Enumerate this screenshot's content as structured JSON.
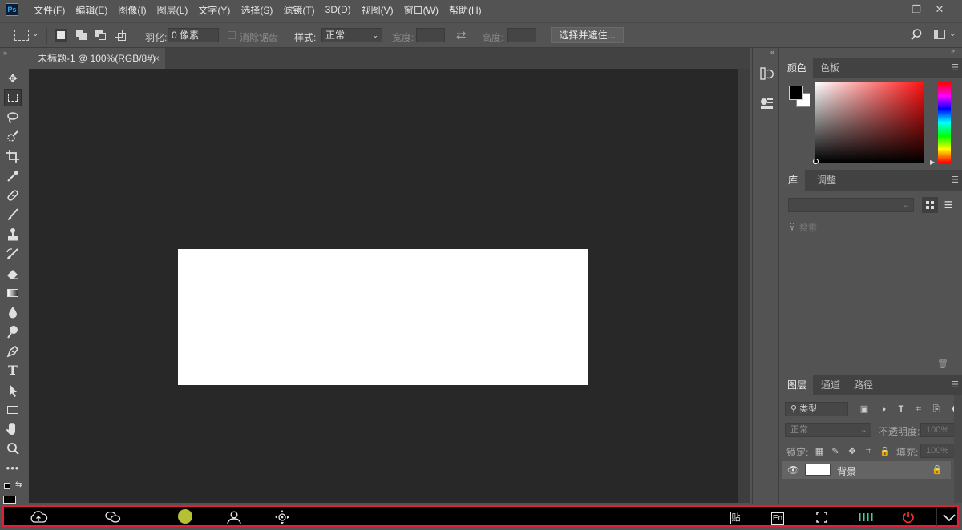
{
  "app": {
    "logo": "Ps"
  },
  "menu": [
    "文件(F)",
    "编辑(E)",
    "图像(I)",
    "图层(L)",
    "文字(Y)",
    "选择(S)",
    "滤镜(T)",
    "3D(D)",
    "视图(V)",
    "窗口(W)",
    "帮助(H)"
  ],
  "window_controls": {
    "minimize": "—",
    "restore": "❐",
    "close": "✕"
  },
  "options": {
    "feather_label": "羽化:",
    "feather_value": "0 像素",
    "antialias_label": "消除锯齿",
    "style_label": "样式:",
    "style_value": "正常",
    "width_label": "宽度:",
    "height_label": "高度:",
    "select_mask_button": "选择并遮住...",
    "swap_icon": "⇄"
  },
  "document": {
    "tab_title": "未标题-1 @ 100%(RGB/8#)",
    "close": "×"
  },
  "panels": {
    "color_tabs": [
      "颜色",
      "色板"
    ],
    "library_tabs": [
      "库",
      "调整"
    ],
    "library_search_placeholder": "搜索",
    "layers_tabs": [
      "图层",
      "通道",
      "路径"
    ],
    "layer_filter": "类型",
    "blend_mode": "正常",
    "opacity_label": "不透明度:",
    "opacity_value": "100%",
    "lock_label": "锁定:",
    "fill_label": "填充:",
    "fill_value": "100%",
    "layer_name": "背景"
  },
  "taskbar": {
    "status_dot_color": "#b5c035",
    "border_color": "#e0203a",
    "icons": [
      "upload-cloud-icon",
      "chat-icon",
      "status-dot",
      "user-icon",
      "move-icon",
      "paste-icon",
      "input-method-icon",
      "fullscreen-icon",
      "signal-bars-icon",
      "power-icon",
      "chevron-down-icon"
    ],
    "paste_glyph": "贴",
    "ime_glyph": "En"
  }
}
